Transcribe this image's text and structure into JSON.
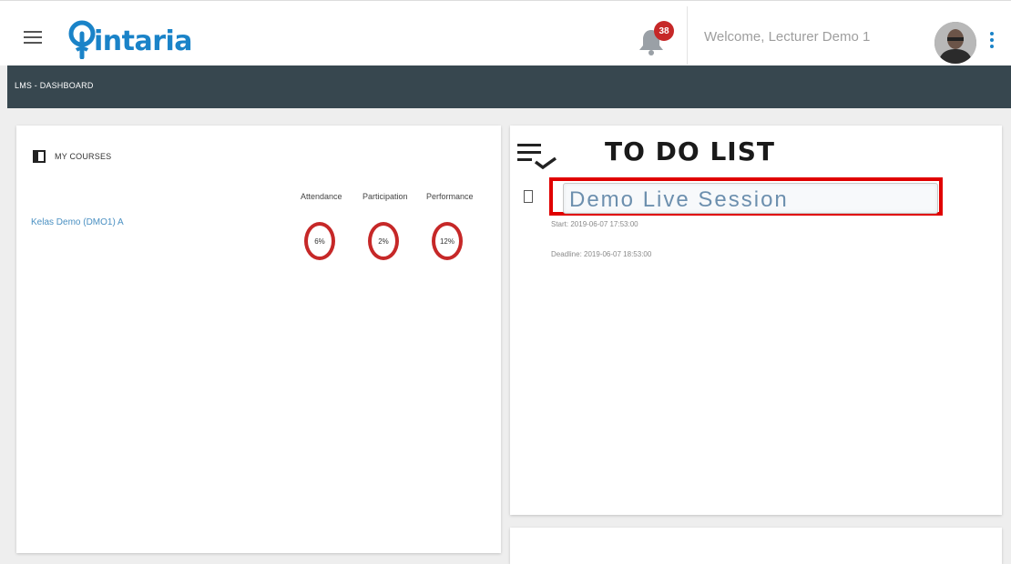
{
  "header": {
    "logo_text": "intaria",
    "notification_count": "38",
    "welcome_text": "Welcome, Lecturer Demo 1"
  },
  "navbar": {
    "breadcrumb": "LMS - DASHBOARD"
  },
  "courses": {
    "title": "MY COURSES",
    "columns": [
      "Attendance",
      "Participation",
      "Performance"
    ],
    "items": [
      {
        "name": "Kelas Demo (DMO1) A",
        "attendance": "6%",
        "participation": "2%",
        "performance": "12%"
      }
    ]
  },
  "todo": {
    "title": "TO DO LIST",
    "items": [
      {
        "name": "Demo Live Session",
        "start": "Start: 2019-06-07 17:53:00",
        "deadline": "Deadline: 2019-06-07 18:53:00"
      }
    ]
  },
  "colors": {
    "brand": "#1a83c8",
    "navbar": "#37474f",
    "badge": "#c62828",
    "highlight": "#e00000"
  }
}
